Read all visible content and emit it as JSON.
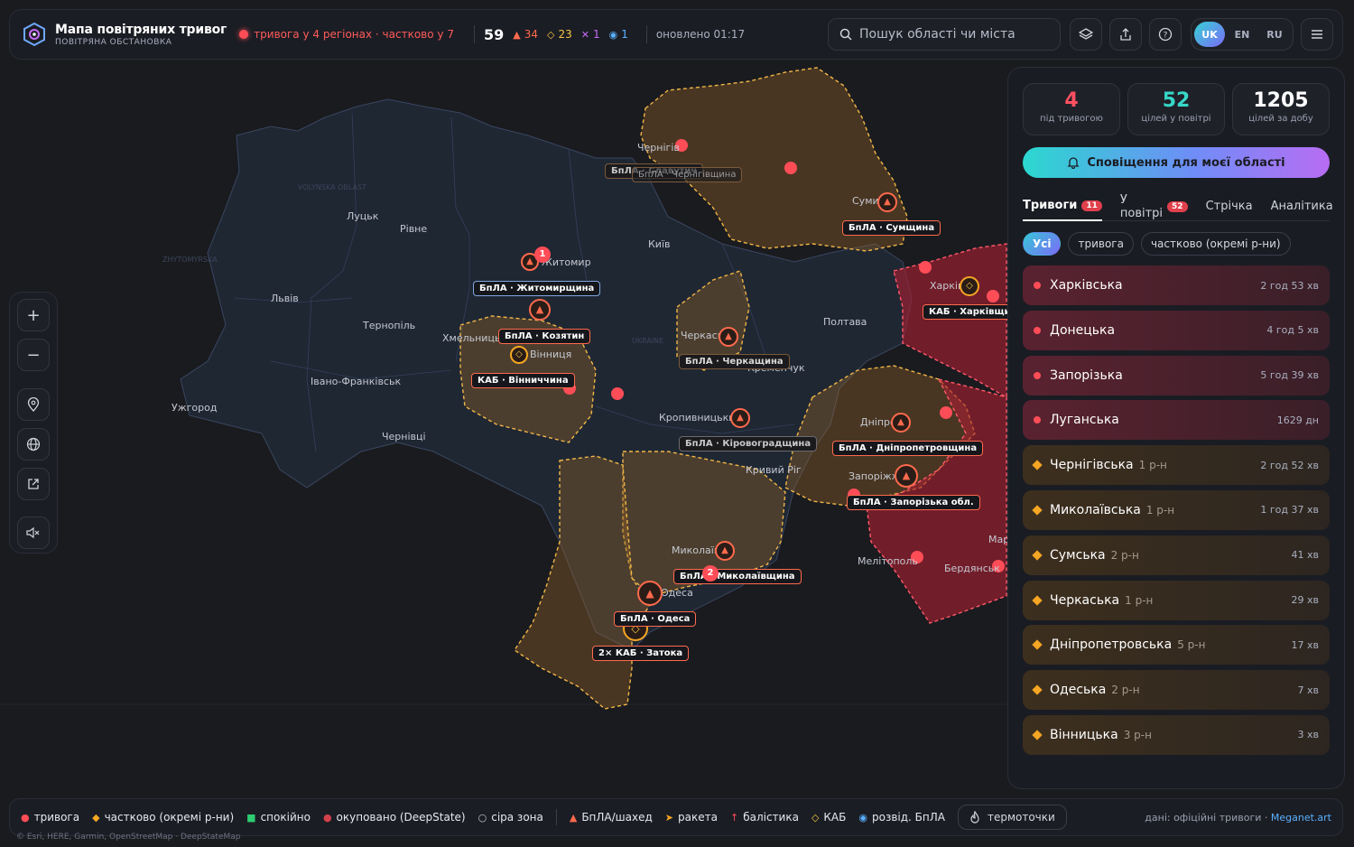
{
  "header": {
    "title": "Мапа повітряних тривог",
    "subtitle": "ПОВІТРЯНА ОБСТАНОВКА",
    "alert_summary": "тривога у 4 регіонах · частково у 7",
    "total": "59",
    "stats": [
      {
        "icon": "▲",
        "value": "34",
        "color": "#ff6a4d"
      },
      {
        "icon": "◇",
        "value": "23",
        "color": "#f5c542"
      },
      {
        "icon": "✕",
        "value": "1",
        "color": "#c56cf3"
      },
      {
        "icon": "◉",
        "value": "1",
        "color": "#5ab0ff"
      }
    ],
    "updated": "оновлено 01:17",
    "search_placeholder": "Пошук області чи міста",
    "langs": [
      "UK",
      "EN",
      "RU"
    ]
  },
  "kpis": [
    {
      "value": "4",
      "label": "під тривогою",
      "color": "#ff5060"
    },
    {
      "value": "52",
      "label": "цілей у повітрі",
      "color": "#36d8c8"
    },
    {
      "value": "1205",
      "label": "цілей за добу",
      "color": "#ffffff"
    }
  ],
  "cta": "Сповіщення для моєї області",
  "tabs": [
    {
      "label": "Тривоги",
      "badge": "11"
    },
    {
      "label": "У повітрі",
      "badge": "52"
    },
    {
      "label": "Стрічка"
    },
    {
      "label": "Аналітика"
    }
  ],
  "filters": [
    "Усі",
    "тривога",
    "частково (окремі р-ни)"
  ],
  "regions": [
    {
      "name": "Харківська",
      "sub": "",
      "time": "2 год 53 хв",
      "kind": "red"
    },
    {
      "name": "Донецька",
      "sub": "",
      "time": "4 год 5 хв",
      "kind": "red"
    },
    {
      "name": "Запорізька",
      "sub": "",
      "time": "5 год 39 хв",
      "kind": "red"
    },
    {
      "name": "Луганська",
      "sub": "",
      "time": "1629 дн",
      "kind": "red"
    },
    {
      "name": "Чернігівська",
      "sub": "1 р-н",
      "time": "2 год 52 хв",
      "kind": "orange"
    },
    {
      "name": "Миколаївська",
      "sub": "1 р-н",
      "time": "1 год 37 хв",
      "kind": "orange"
    },
    {
      "name": "Сумська",
      "sub": "2 р-н",
      "time": "41 хв",
      "kind": "orange"
    },
    {
      "name": "Черкаська",
      "sub": "1 р-н",
      "time": "29 хв",
      "kind": "orange"
    },
    {
      "name": "Дніпропетровська",
      "sub": "5 р-н",
      "time": "17 хв",
      "kind": "orange"
    },
    {
      "name": "Одеська",
      "sub": "2 р-н",
      "time": "7 хв",
      "kind": "orange"
    },
    {
      "name": "Вінницька",
      "sub": "3 р-н",
      "time": "3 хв",
      "kind": "orange"
    }
  ],
  "legend": [
    {
      "sym": "●",
      "label": "тривога",
      "color": "#ff4d57"
    },
    {
      "sym": "◆",
      "label": "частково (окремі р-ни)",
      "color": "#f5a623"
    },
    {
      "sym": "■",
      "label": "спокійно",
      "color": "#2ecc71"
    },
    {
      "sym": "●",
      "label": "окуповано (DeepState)",
      "color": "#d2414b"
    },
    {
      "sym": "○",
      "label": "сіра зона",
      "color": "#c0c4cc"
    },
    {
      "sym": "▲",
      "label": "БпЛА/шахед",
      "color": "#ff6a4d"
    },
    {
      "sym": "➤",
      "label": "ракета",
      "color": "#f5a623"
    },
    {
      "sym": "↑",
      "label": "балістика",
      "color": "#ff4d57"
    },
    {
      "sym": "◇",
      "label": "КАБ",
      "color": "#f5c542"
    },
    {
      "sym": "◉",
      "label": "розвід. БпЛА",
      "color": "#5ab0ff"
    }
  ],
  "thermo": "термоточки",
  "source_prefix": "дані: офіційні тривоги · ",
  "source_link": "Meganet.art",
  "attribution": "© Esri, HERE, Garmin, OpenStreetMap · DeepStateMap",
  "cities": [
    {
      "name": "Луцьк"
    },
    {
      "name": "Рівне"
    },
    {
      "name": "Львів"
    },
    {
      "name": "Тернопіль"
    },
    {
      "name": "Хмельницький"
    },
    {
      "name": "Івано-Франківськ"
    },
    {
      "name": "Ужгород"
    },
    {
      "name": "Чернівці"
    },
    {
      "name": "Житомир"
    },
    {
      "name": "Київ"
    },
    {
      "name": "Вінниця"
    },
    {
      "name": "Чернігів"
    },
    {
      "name": "Суми"
    },
    {
      "name": "Харків"
    },
    {
      "name": "Полтава"
    },
    {
      "name": "Черкаси"
    },
    {
      "name": "Кременчук"
    },
    {
      "name": "Кропивницький"
    },
    {
      "name": "Кривий Ріг"
    },
    {
      "name": "Дніпро"
    },
    {
      "name": "Запоріжжя"
    },
    {
      "name": "Миколаїв"
    },
    {
      "name": "Одеса"
    },
    {
      "name": "Мелітополь"
    },
    {
      "name": "Бердянськ"
    },
    {
      "name": "Мар"
    }
  ],
  "threats": [
    {
      "label": "БпЛА · Житомирщина"
    },
    {
      "label": "БпЛА · Козятин"
    },
    {
      "label": "КАБ · Вінниччина"
    },
    {
      "label": "БпЛА · Сумщина"
    },
    {
      "label": "КАБ · Харківщин"
    },
    {
      "label": "БпЛА · Черкащина"
    },
    {
      "label": "БпЛА · Кіровоградщина"
    },
    {
      "label": "БпЛА · Дніпропетровщина"
    },
    {
      "label": "БпЛА · Запорізька обл."
    },
    {
      "label": "БпЛА · Миколаївщина"
    },
    {
      "label": "БпЛА · Одеса"
    },
    {
      "label": "2× КАБ · Затока"
    },
    {
      "label": "БпЛА · Славутич"
    },
    {
      "label": "БпЛА · Чернігівщина"
    }
  ]
}
